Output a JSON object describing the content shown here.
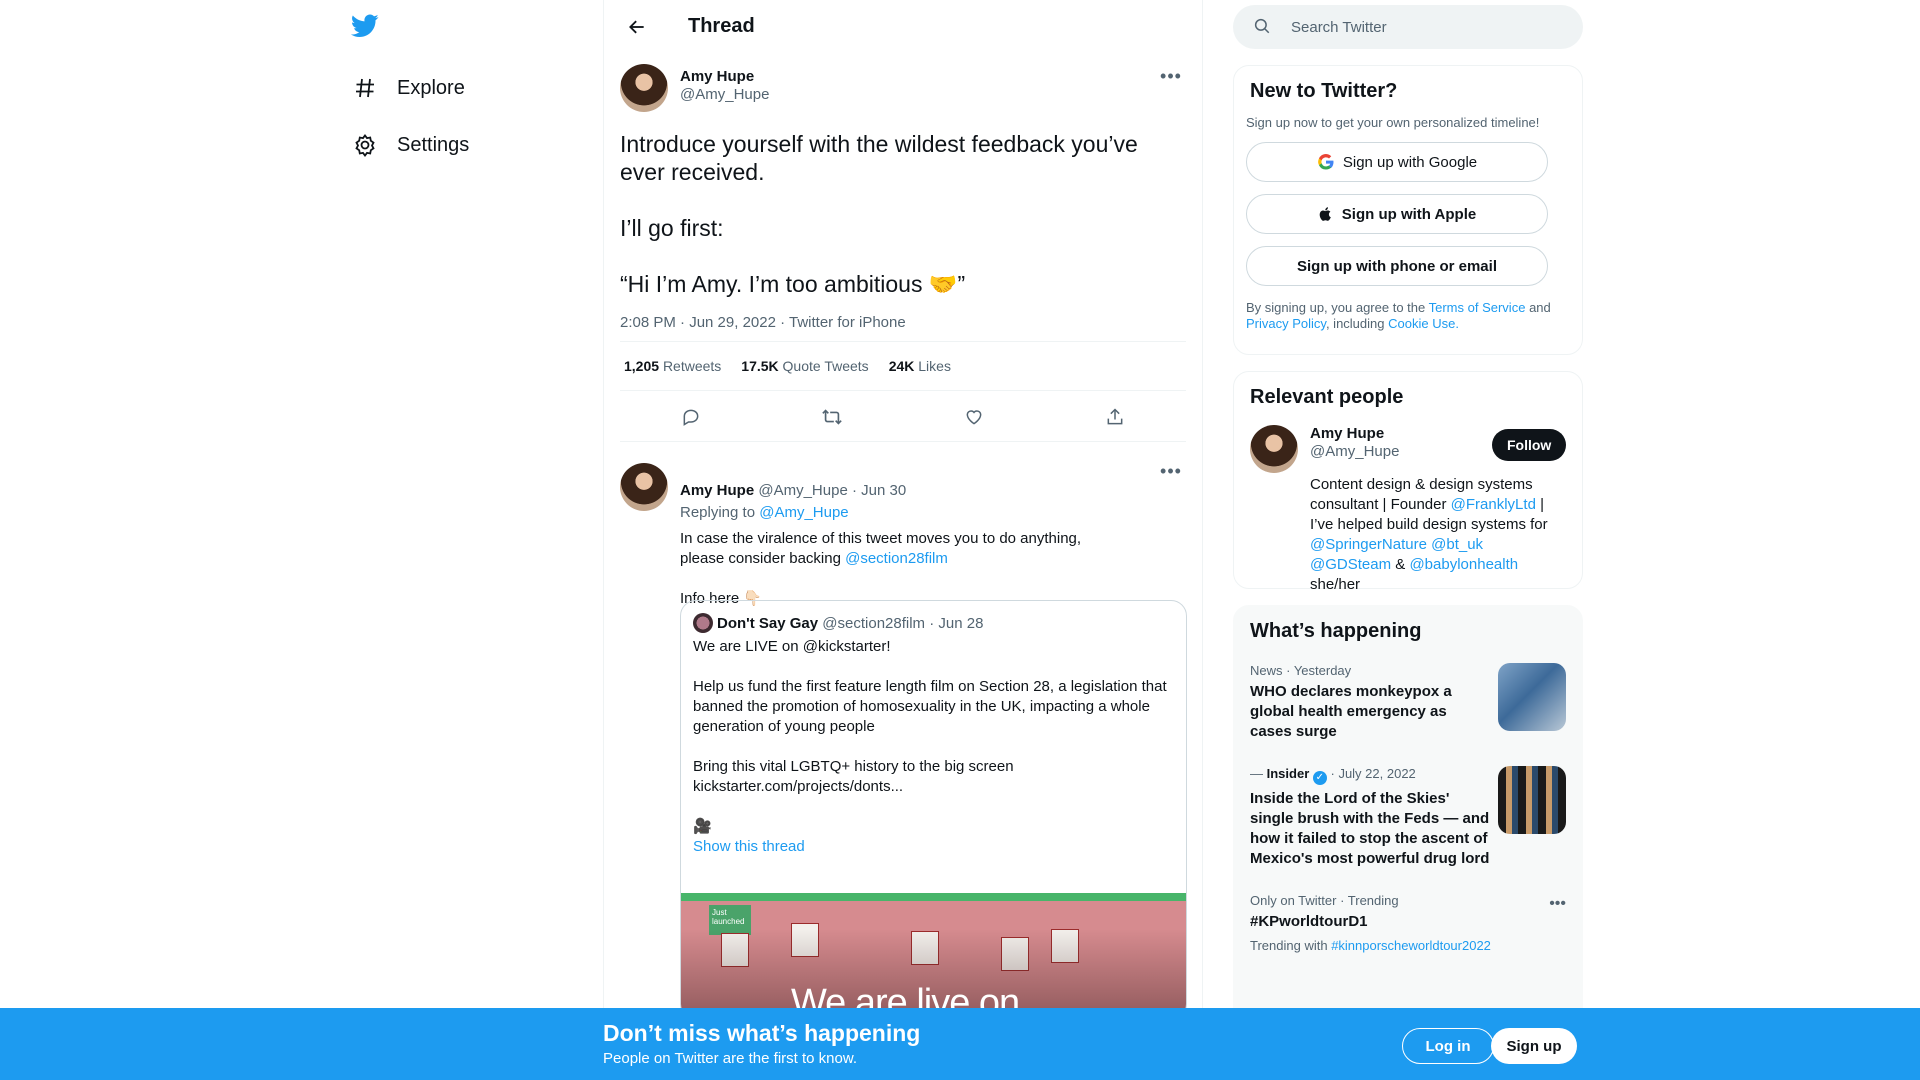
{
  "nav": {
    "items": [
      {
        "label": "Explore",
        "icon": "hashtag-icon"
      },
      {
        "label": "Settings",
        "icon": "gear-icon"
      }
    ]
  },
  "thread": {
    "title": "Thread",
    "main": {
      "name": "Amy Hupe",
      "handle": "@Amy_Hupe",
      "text": [
        "Introduce yourself with the wildest feedback you’ve ever received.",
        "I’ll go first:",
        "“Hi I’m Amy. I’m too ambitious 🤝”"
      ],
      "meta": "2:08 PM · Jun 29, 2022 · Twitter for iPhone",
      "stats": [
        {
          "value": "1,205",
          "label": "Retweets"
        },
        {
          "value": "17.5K",
          "label": "Quote Tweets"
        },
        {
          "value": "24K",
          "label": "Likes"
        }
      ]
    },
    "reply": {
      "name": "Amy Hupe",
      "handle": "@Amy_Hupe",
      "date": "· Jun 30",
      "replying_prefix": "Replying to",
      "replying_handle": "@Amy_Hupe",
      "text": "In case the viralence of this tweet moves you to do anything, please consider backing",
      "text_link": "@section28film",
      "info": "Info here 👇🏻",
      "quote": {
        "name": "Don't Say Gay",
        "handle": "@section28film",
        "date": "· Jun 28",
        "lines": [
          "We are LIVE on @kickstarter!",
          "Help us fund the first feature length film on Section 28, a legislation that banned the promotion of homosexuality in the UK, impacting a whole generation of young people",
          "Bring this vital LGBTQ+ history to the big screen",
          "kickstarter.com/projects/donts..."
        ],
        "emoji": "🎥",
        "show_thread": "Show this thread",
        "media_badge": "Just launched",
        "media_text": "We are live on"
      }
    }
  },
  "search": {
    "placeholder": "Search Twitter"
  },
  "new_to_twitter": {
    "title": "New to Twitter?",
    "subtitle": "Sign up now to get your own personalized timeline!",
    "google": "Sign up with Google",
    "apple": "Sign up with Apple",
    "phone": "Sign up with phone or email",
    "legal_1": "By signing up, you agree to the",
    "terms": "Terms of Service",
    "and": "and",
    "privacy": "Privacy Policy",
    "including": ", including",
    "cookie": "Cookie Use."
  },
  "relevant": {
    "title": "Relevant people",
    "name": "Amy Hupe",
    "handle": "@Amy_Hupe",
    "follow": "Follow",
    "bio_1": "Content design & design systems consultant | Founder",
    "bio_link1": "@FranklyLtd",
    "bio_2": "| I’ve helped build design systems for",
    "bio_link2": "@SpringerNature",
    "bio_link3": "@bt_uk",
    "bio_link4": "@GDSteam",
    "bio_amp": "&",
    "bio_link5": "@babylonhealth",
    "bio_end": "she/her"
  },
  "happening": {
    "title": "What’s happening",
    "trends": [
      {
        "meta": "News · Yesterday",
        "title": "WHO declares monkeypox a global health emergency as cases surge"
      },
      {
        "meta_source": "Insider",
        "meta_date": "· July 22, 2022",
        "title": "Inside the Lord of the Skies' single brush with the Feds — and how it failed to stop the ascent of Mexico's most powerful drug lord"
      },
      {
        "meta": "Only on Twitter · Trending",
        "title": "#KPworldtourD1",
        "with_prefix": "Trending with",
        "with_tag": "#kinnporscheworldtour2022"
      }
    ]
  },
  "bottom": {
    "title": "Don’t miss what’s happening",
    "subtitle": "People on Twitter are the first to know.",
    "login": "Log in",
    "signup": "Sign up"
  },
  "colors": {
    "accent": "#1d9bf0",
    "text": "#0f1419",
    "muted": "#536471"
  }
}
